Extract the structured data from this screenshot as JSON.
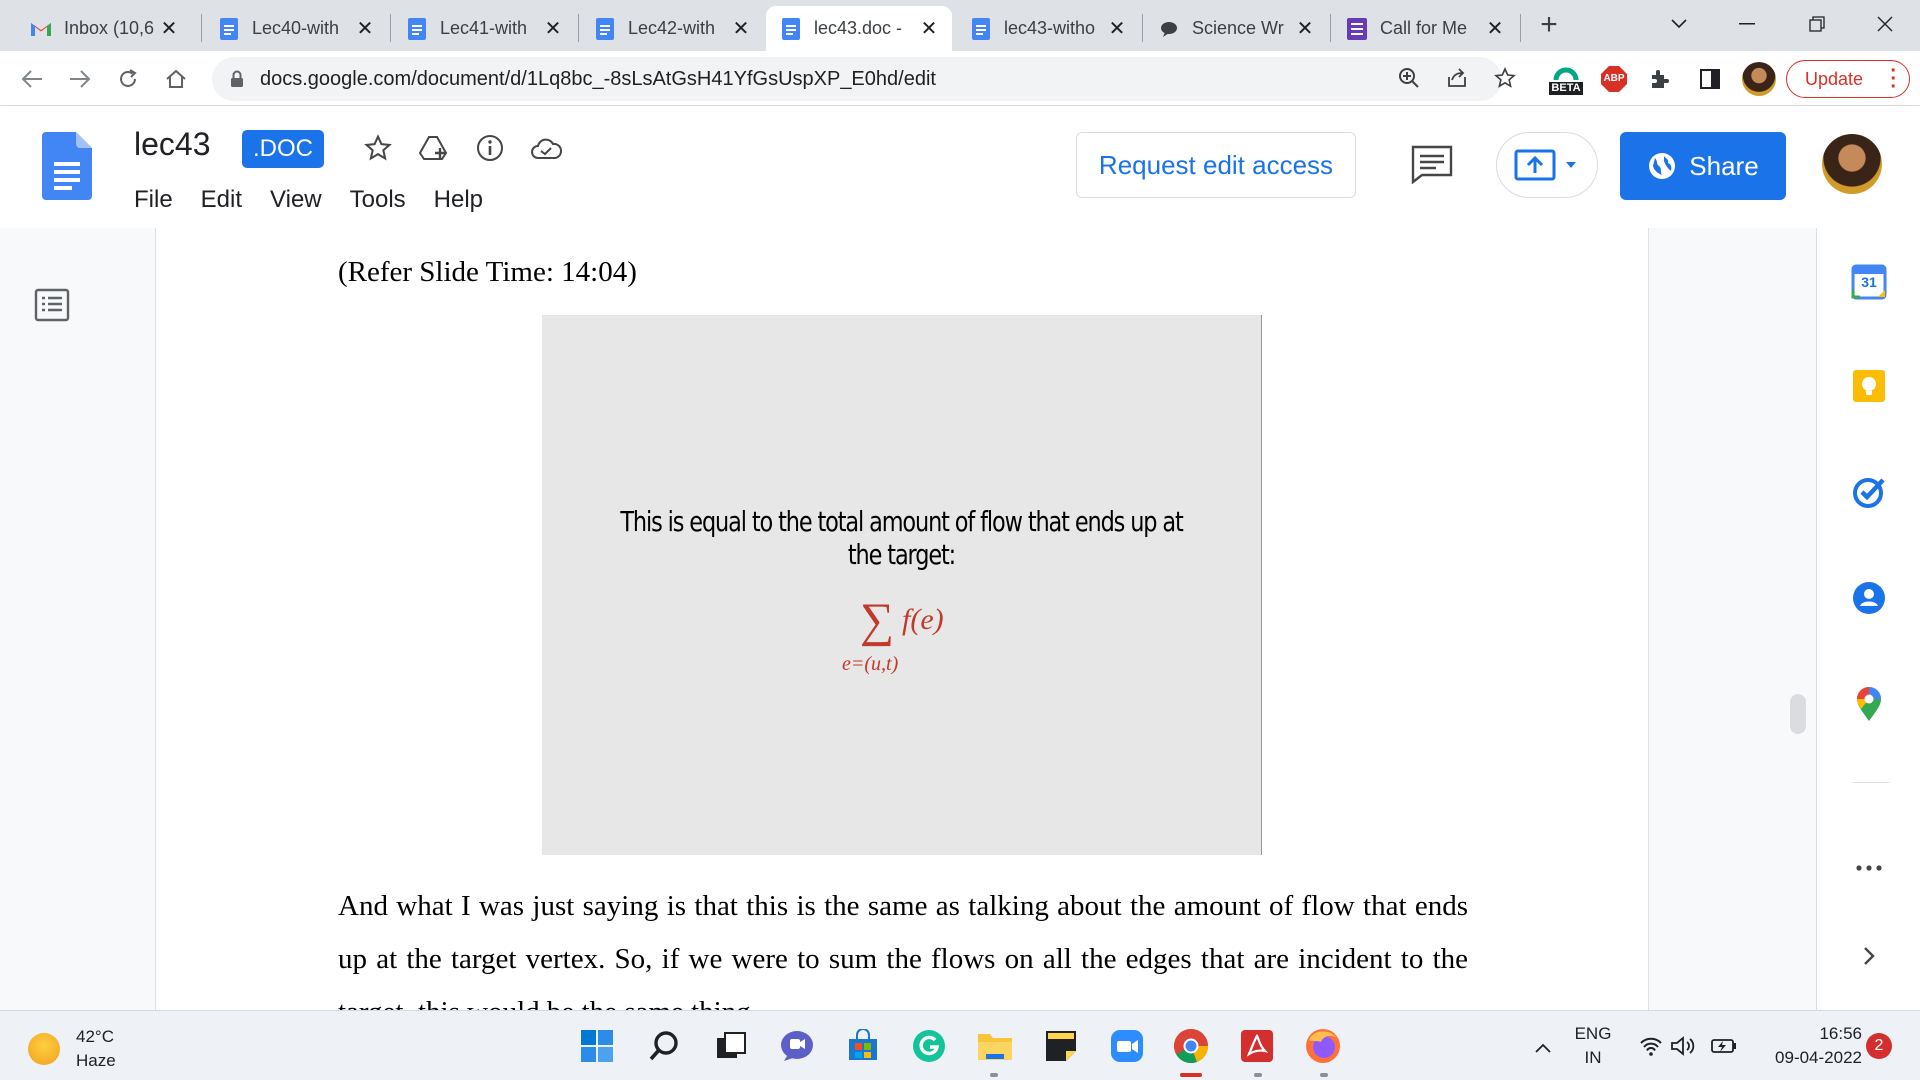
{
  "browser": {
    "tabs": [
      {
        "title": "Inbox (10,6",
        "icon": "gmail-icon",
        "active": false
      },
      {
        "title": "Lec40-with",
        "icon": "docs-icon",
        "active": false
      },
      {
        "title": "Lec41-with",
        "icon": "docs-icon",
        "active": false
      },
      {
        "title": "Lec42-with",
        "icon": "docs-icon",
        "active": false
      },
      {
        "title": "lec43.doc -",
        "icon": "docs-icon",
        "active": true
      },
      {
        "title": "lec43-witho",
        "icon": "docs-icon",
        "active": false
      },
      {
        "title": "Science Wr",
        "icon": "chat-icon",
        "active": false
      },
      {
        "title": "Call for Me",
        "icon": "forms-icon",
        "active": false
      }
    ],
    "url": "docs.google.com/document/d/1Lq8bc_-8sLsAtGsH41YfGsUspXP_E0hd/edit",
    "extension_beta": "BETA",
    "extension_abp": "ABP",
    "update_label": "Update"
  },
  "docs": {
    "title": "lec43",
    "badge": ".DOC",
    "menu": [
      "File",
      "Edit",
      "View",
      "Tools",
      "Help"
    ],
    "request_edit_label": "Request edit access",
    "share_label": "Share",
    "accent": "#1a73e8"
  },
  "document": {
    "ref_time": "(Refer Slide Time: 14:04)",
    "slide_text": "This is equal to the total amount of flow that ends up at the target:",
    "formula_sigma": "∑",
    "formula_term": "f(e)",
    "formula_sub": "e=(u,t)",
    "formula_color": "#c0392b",
    "paragraph": "And what I was just saying is that this is the same as talking about the amount of flow that ends up at the target vertex. So, if we were to sum the flows on all the edges that are incident to the target, this would be the same thing."
  },
  "side_panel": {
    "calendar_day": "31"
  },
  "taskbar": {
    "temperature": "42°C",
    "weather": "Haze",
    "lang_primary": "ENG",
    "lang_secondary": "IN",
    "time": "16:56",
    "date": "09-04-2022",
    "notifications": "2"
  }
}
